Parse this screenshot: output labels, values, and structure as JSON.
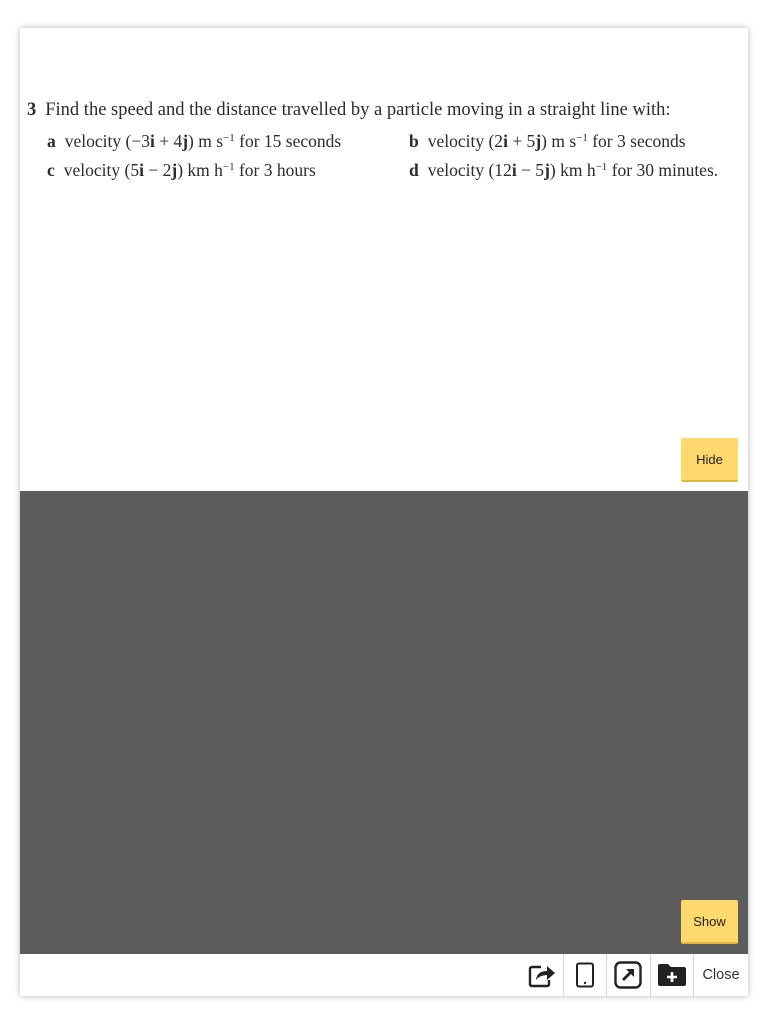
{
  "question": {
    "number": "3",
    "stem": "Find the speed and the distance travelled by a particle moving in a straight line with:",
    "parts": [
      {
        "label": "a",
        "pre": "velocity (−3",
        "i": "i",
        "mid": " + 4",
        "j": "j",
        "post": ") m s",
        "exp": "−1",
        "tail": " for 15 seconds"
      },
      {
        "label": "b",
        "pre": "velocity (2",
        "i": "i",
        "mid": " + 5",
        "j": "j",
        "post": ") m s",
        "exp": "−1",
        "tail": " for 3 seconds"
      },
      {
        "label": "c",
        "pre": "velocity (5",
        "i": "i",
        "mid": " − 2",
        "j": "j",
        "post": ") km h",
        "exp": "−1",
        "tail": " for 3 hours"
      },
      {
        "label": "d",
        "pre": "velocity (12",
        "i": "i",
        "mid": " − 5",
        "j": "j",
        "post": ") km h",
        "exp": "−1",
        "tail": " for 30 minutes."
      }
    ]
  },
  "buttons": {
    "hide": "Hide",
    "show": "Show"
  },
  "toolbar": {
    "icons": [
      "share-icon",
      "tablet-icon",
      "external-link-icon",
      "add-folder-icon"
    ],
    "close": "Close"
  },
  "colors": {
    "button": "#ffd86e",
    "answer_panel": "#5c5c5c"
  }
}
